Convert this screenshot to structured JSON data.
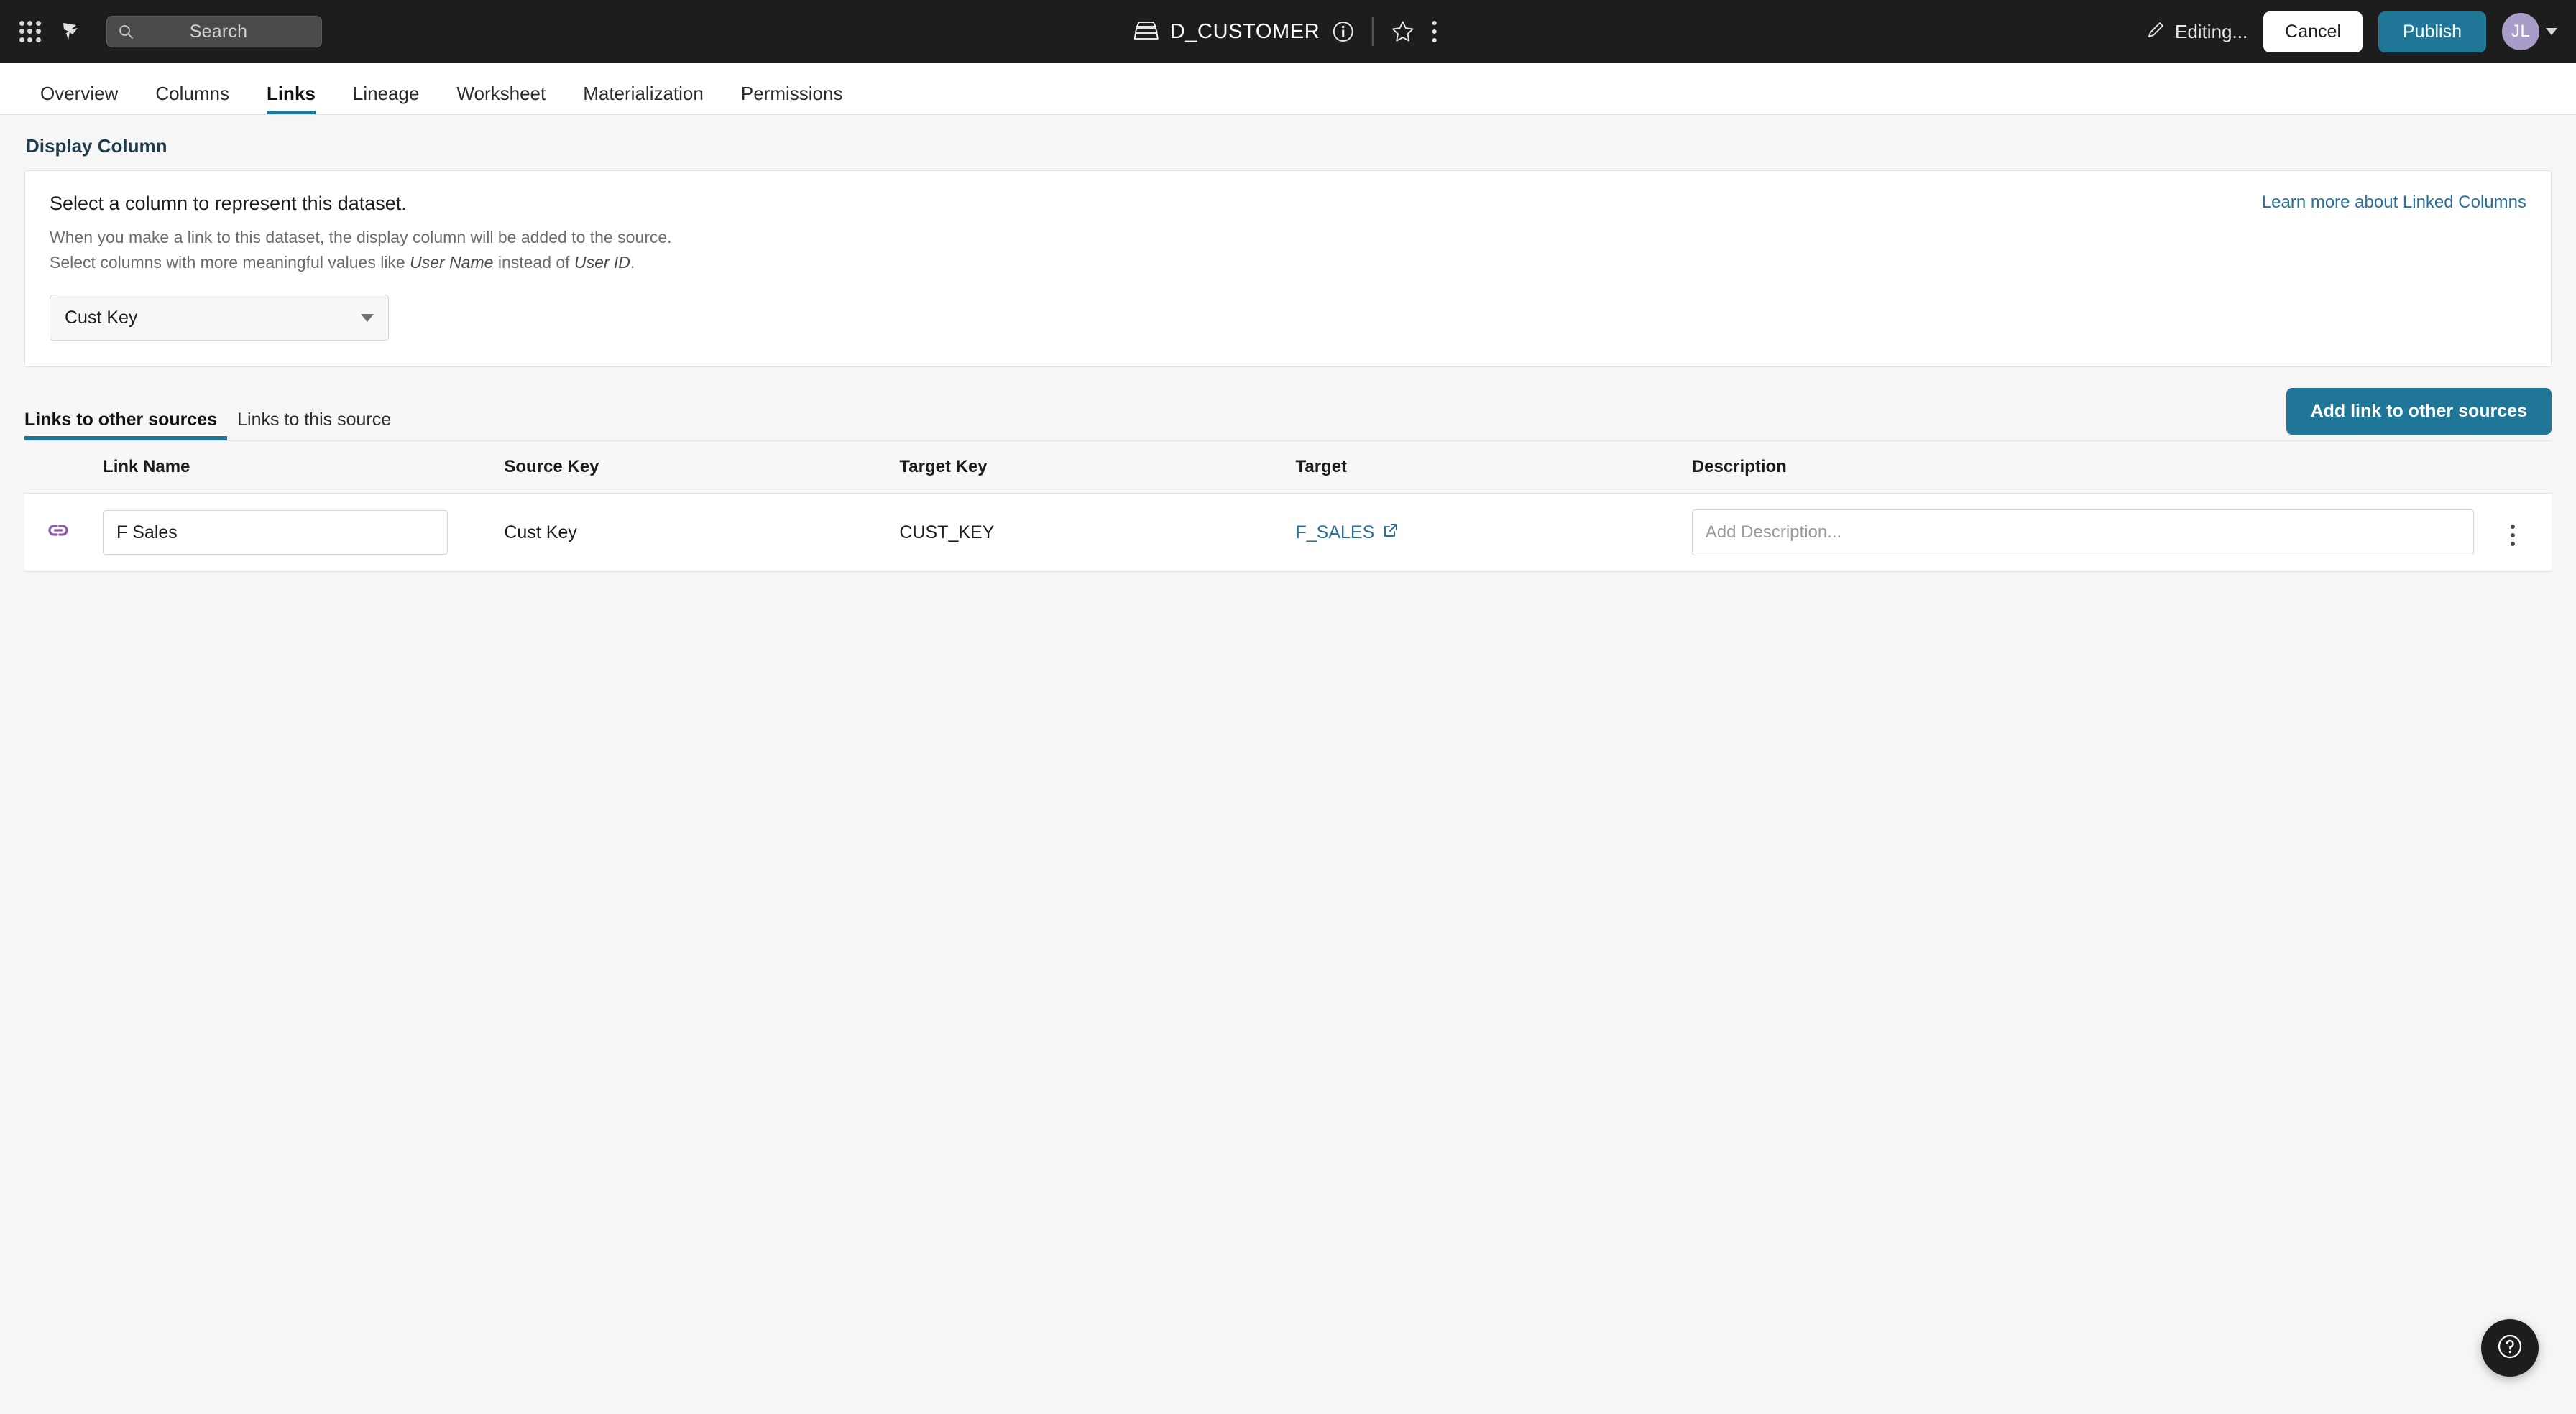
{
  "topbar": {
    "apps_icon": "grid-apps-icon",
    "logo_icon": "origami-bird-logo",
    "search": {
      "placeholder": "Search",
      "icon": "search-icon"
    },
    "dataset": {
      "icon": "database-stack-icon",
      "title": "D_CUSTOMER",
      "info_icon": "info-circle-icon",
      "star_icon": "star-outline-icon",
      "more_icon": "more-vertical-icon"
    },
    "editing": {
      "icon": "pencil-icon",
      "label": "Editing..."
    },
    "cancel_label": "Cancel",
    "publish_label": "Publish",
    "avatar": {
      "initials": "JL",
      "chevron_icon": "chevron-down-icon"
    }
  },
  "tabs": [
    {
      "label": "Overview",
      "active": false
    },
    {
      "label": "Columns",
      "active": false
    },
    {
      "label": "Links",
      "active": true
    },
    {
      "label": "Lineage",
      "active": false
    },
    {
      "label": "Worksheet",
      "active": false
    },
    {
      "label": "Materialization",
      "active": false
    },
    {
      "label": "Permissions",
      "active": false
    }
  ],
  "display_column": {
    "section_title": "Display Column",
    "heading": "Select a column to represent this dataset.",
    "desc_line1": "When you make a link to this dataset, the display column will be added to the source.",
    "desc_line2_pre": "Select columns with more meaningful values like ",
    "desc_line2_em1": "User Name",
    "desc_line2_mid": " instead of ",
    "desc_line2_em2": "User ID",
    "desc_line2_post": ".",
    "learn_more_label": "Learn more about Linked Columns",
    "select_value": "Cust Key",
    "select_caret_icon": "caret-down-icon"
  },
  "links_section": {
    "subtabs": [
      {
        "label": "Links to other sources",
        "active": true
      },
      {
        "label": "Links to this source",
        "active": false
      }
    ],
    "add_button_label": "Add link to other sources",
    "columns": [
      "",
      "Link Name",
      "Source Key",
      "Target Key",
      "Target",
      "Description",
      ""
    ],
    "rows": [
      {
        "link_icon": "chain-link-icon",
        "link_name": "F Sales",
        "source_key": "Cust Key",
        "target_key": "CUST_KEY",
        "target": "F_SALES",
        "target_external_icon": "external-link-icon",
        "description_value": "",
        "description_placeholder": "Add Description...",
        "menu_icon": "more-vertical-icon"
      }
    ]
  },
  "help_fab": {
    "icon": "question-circle-icon"
  },
  "colors": {
    "accent_teal": "#1f7696",
    "link_blue": "#2a7099",
    "header_dark": "#1d1d1d",
    "chain_purple": "#8e59a8",
    "avatar_purple": "#a99cc8",
    "section_title": "#1d3c4c"
  }
}
